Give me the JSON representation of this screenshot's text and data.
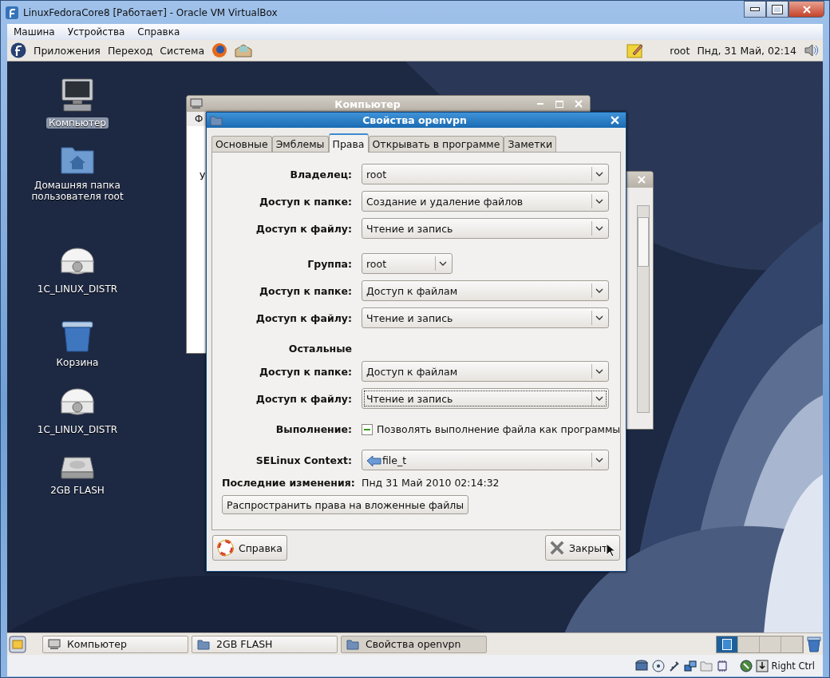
{
  "host": {
    "title": "LinuxFedoraCore8 [Работает] - Oracle VM VirtualBox",
    "menu": [
      "Машина",
      "Устройства",
      "Справка"
    ],
    "status_key": "Right Ctrl"
  },
  "top_panel": {
    "menus": [
      "Приложения",
      "Переход",
      "Система"
    ],
    "user": "root",
    "clock": "Пнд, 31 Май, 02:14"
  },
  "desktop_icons": [
    {
      "kind": "computer",
      "label": "Компьютер",
      "selected": true
    },
    {
      "kind": "home",
      "label": "Домашняя папка пользователя root",
      "selected": false
    },
    {
      "kind": "drive",
      "label": "1C_LINUX_DISTR",
      "selected": false
    },
    {
      "kind": "trash",
      "label": "Корзина",
      "selected": false
    },
    {
      "kind": "drive",
      "label": "1C_LINUX_DISTR",
      "selected": false
    },
    {
      "kind": "flash",
      "label": "2GB FLASH",
      "selected": false
    }
  ],
  "background_window": {
    "title": "Компьютер",
    "menu": "Ф",
    "fragment": "У"
  },
  "dialog": {
    "title": "Свойства openvpn",
    "tabs": [
      {
        "label": "Основные",
        "selected": false
      },
      {
        "label": "Эмблемы",
        "selected": false
      },
      {
        "label": "Права",
        "selected": true
      },
      {
        "label": "Открывать в программе",
        "selected": false
      },
      {
        "label": "Заметки",
        "selected": false
      }
    ],
    "sections": [
      [
        {
          "kind": "combo",
          "label": "Владелец:",
          "value": "root",
          "compact": false,
          "focused": false
        },
        {
          "kind": "combo",
          "label": "Доступ к папке:",
          "value": "Создание и удаление файлов",
          "compact": false,
          "focused": false
        },
        {
          "kind": "combo",
          "label": "Доступ к файлу:",
          "value": "Чтение и запись",
          "compact": false,
          "focused": false
        }
      ],
      [
        {
          "kind": "combo",
          "label": "Группа:",
          "value": "root",
          "compact": true,
          "focused": false
        },
        {
          "kind": "combo",
          "label": "Доступ к папке:",
          "value": "Доступ к файлам",
          "compact": false,
          "focused": false
        },
        {
          "kind": "combo",
          "label": "Доступ к файлу:",
          "value": "Чтение и запись",
          "compact": false,
          "focused": false
        }
      ],
      [
        {
          "kind": "heading",
          "label": "Остальные"
        },
        {
          "kind": "combo",
          "label": "Доступ к папке:",
          "value": "Доступ к файлам",
          "compact": false,
          "focused": false
        },
        {
          "kind": "combo",
          "label": "Доступ к файлу:",
          "value": "Чтение и запись",
          "compact": false,
          "focused": true
        }
      ],
      [
        {
          "kind": "checkbox",
          "label": "Выполнение:",
          "text": "Позволять выполнение файла как программы",
          "mixed": true
        }
      ],
      [
        {
          "kind": "combo",
          "label": "SELinux Context:",
          "value": "file_t",
          "compact": false,
          "focused": false,
          "icon": true
        },
        {
          "kind": "info",
          "label": "Последние изменения:",
          "value": "Пнд 31 Май 2010 02:14:32"
        },
        {
          "kind": "button",
          "text": "Распространить права на вложенные файлы"
        }
      ]
    ],
    "buttons": [
      {
        "kind": "help",
        "label": "Справка"
      },
      {
        "kind": "close",
        "label": "Закрыт"
      }
    ]
  },
  "taskbar": {
    "items": [
      {
        "kind": "computer",
        "label": "Компьютер",
        "selected": false
      },
      {
        "kind": "folder",
        "label": "2GB FLASH",
        "selected": false
      },
      {
        "kind": "folder",
        "label": "Свойства openvpn",
        "selected": true
      }
    ],
    "workspaces": [
      {
        "selected": true
      },
      {
        "selected": false
      },
      {
        "selected": false
      },
      {
        "selected": false
      }
    ]
  }
}
